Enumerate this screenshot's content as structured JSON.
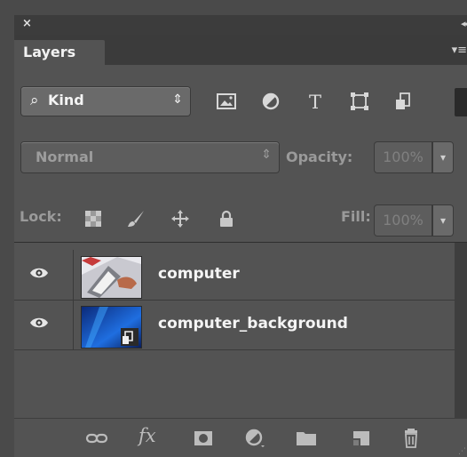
{
  "panel": {
    "close_glyph": "×",
    "collapse_glyph": "◂◂",
    "tab_label": "Layers",
    "menu_glyph": "▾≡"
  },
  "filter": {
    "search_glyph": "⌕",
    "kind_label": "Kind",
    "updown_glyph": "⇕",
    "icons": [
      "pixel-layer-filter-icon",
      "adjustment-layer-filter-icon",
      "type-layer-filter-icon",
      "shape-layer-filter-icon",
      "smart-object-filter-icon"
    ],
    "type_glyph": "T"
  },
  "blend": {
    "mode": "Normal",
    "opacity_label": "Opacity:",
    "opacity_value": "100%"
  },
  "lock": {
    "label": "Lock:",
    "icons": [
      "lock-transparent-pixels-icon",
      "lock-image-pixels-icon",
      "lock-position-icon",
      "lock-all-icon"
    ],
    "fill_label": "Fill:",
    "fill_value": "100%"
  },
  "layers": [
    {
      "name": "computer",
      "visible": true,
      "thumbnail": "photo-thumbnail"
    },
    {
      "name": "computer_background",
      "visible": true,
      "thumbnail": "smart-object-thumbnail"
    }
  ],
  "toolbar": {
    "fx_label": "fx",
    "icons": [
      "link-layers-icon",
      "add-layer-style-icon",
      "add-mask-icon",
      "new-adjustment-layer-icon",
      "new-group-icon",
      "new-layer-icon",
      "delete-layer-icon"
    ]
  },
  "colors": {
    "panel_bg": "#535353",
    "header_bg": "#3b3b3b",
    "control_bg": "#6a6a6a",
    "disabled_text": "#808080"
  }
}
